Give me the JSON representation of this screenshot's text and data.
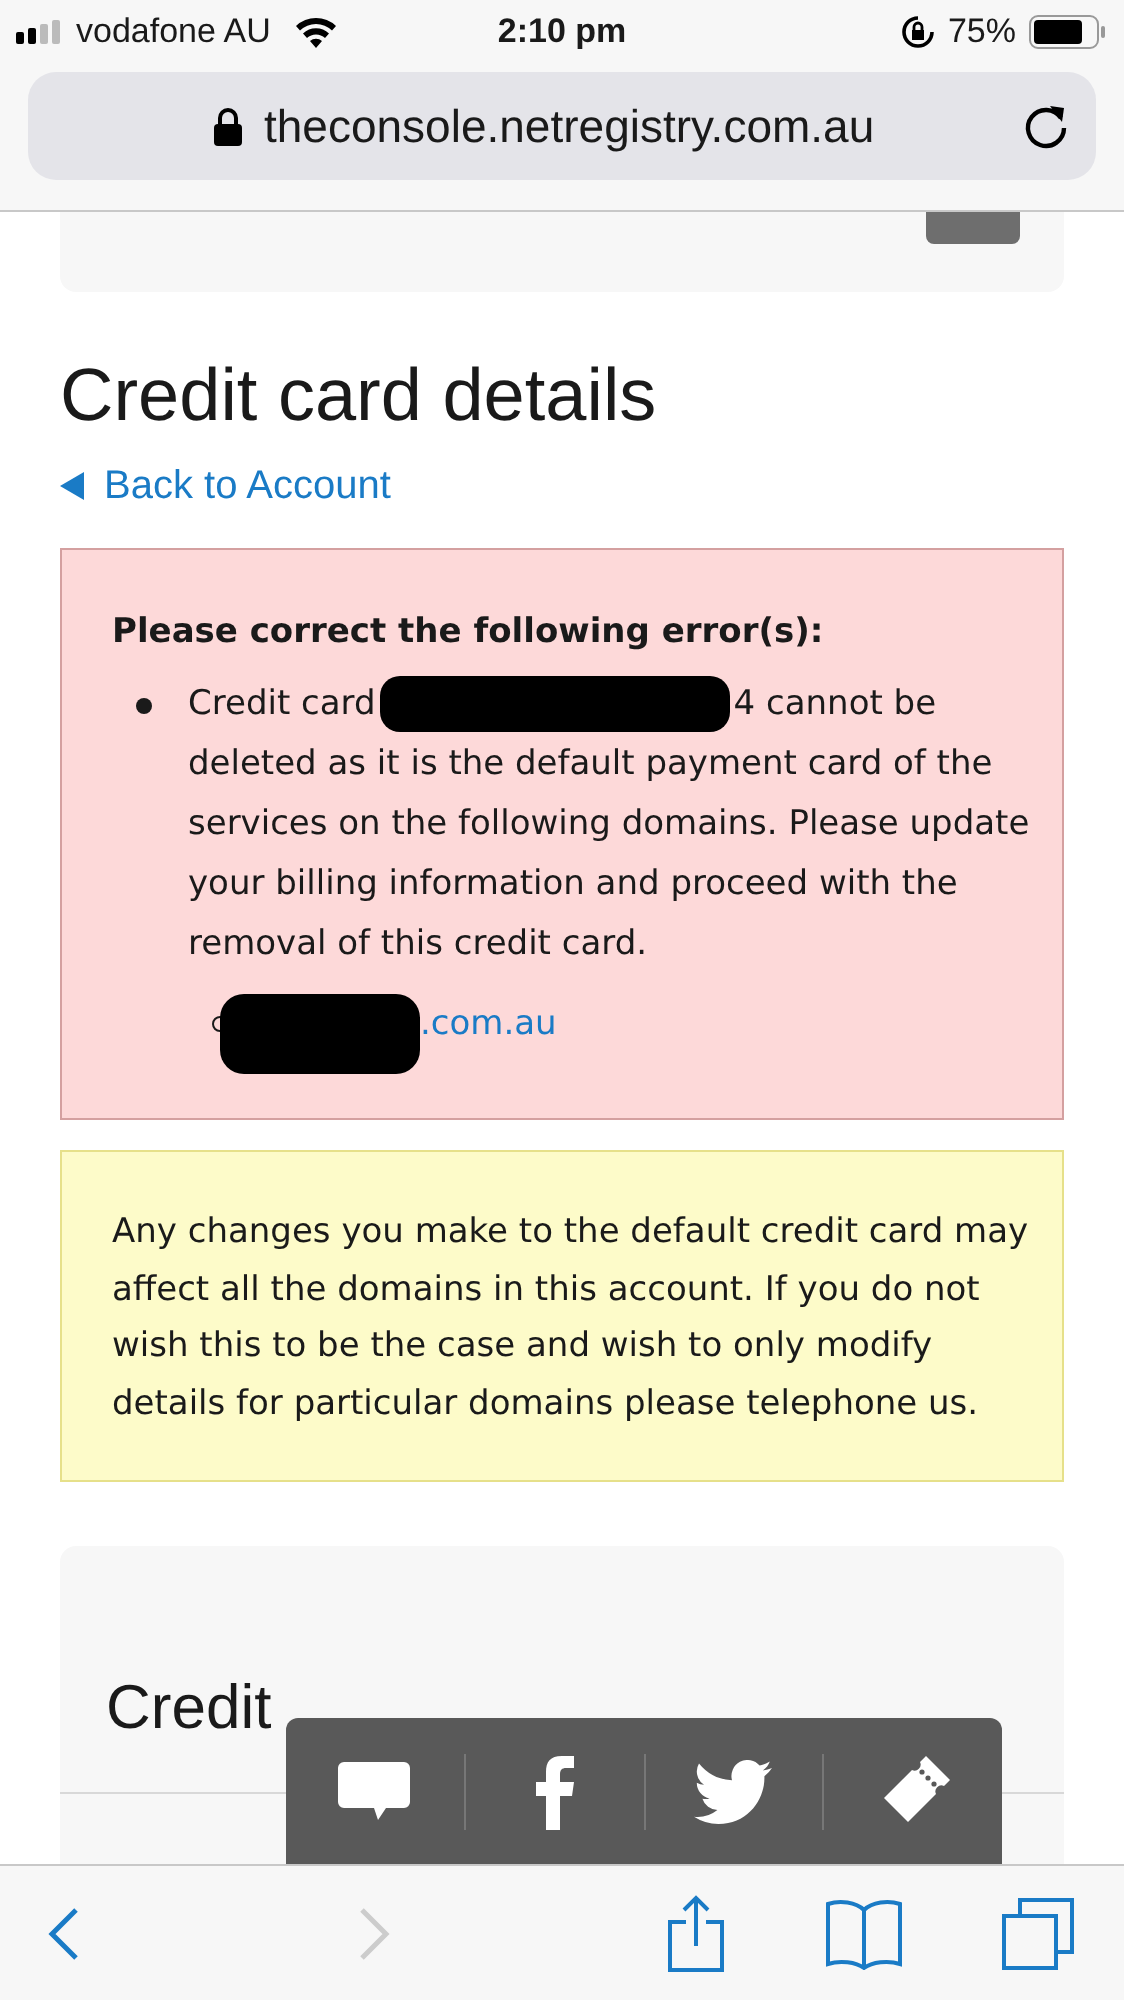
{
  "status_bar": {
    "carrier": "vodafone AU",
    "time": "2:10 pm",
    "battery": "75%"
  },
  "address_bar": {
    "url": "theconsole.netregistry.com.au"
  },
  "page": {
    "title": "Credit card details",
    "back_link": "Back to Account"
  },
  "error_box": {
    "heading": "Please correct the following error(s):",
    "message_start": "Credit card",
    "message_end": "4 cannot be deleted as it is the default payment card of the services on the following domains. Please update your billing information and proceed with the removal of this credit card.",
    "domains": [
      ".com.au"
    ]
  },
  "notice_box": {
    "text": "Any changes you make to the default credit card may affect all the domains in this account. If you do not wish this to be the case and wish to only modify details for particular domains please telephone us."
  },
  "cards_section": {
    "title": "Credit"
  },
  "share_bar": {
    "items": [
      {
        "kind": "comment"
      },
      {
        "kind": "facebook"
      },
      {
        "kind": "twitter"
      },
      {
        "kind": "ticket"
      }
    ]
  },
  "toolbar": {
    "back_enabled": true,
    "forward_enabled": false
  }
}
